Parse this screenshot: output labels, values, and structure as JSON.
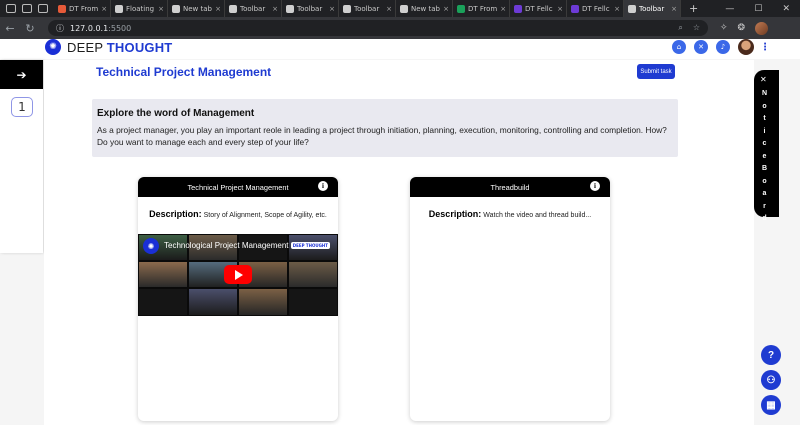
{
  "browser": {
    "tabs": [
      {
        "label": "DT From",
        "color": "#e65a39"
      },
      {
        "label": "Floating",
        "color": "#cfcfcf"
      },
      {
        "label": "New tab",
        "color": "#cfcfcf"
      },
      {
        "label": "Toolbar",
        "color": "#cfcfcf"
      },
      {
        "label": "Toolbar",
        "color": "#cfcfcf"
      },
      {
        "label": "Toolbar",
        "color": "#cfcfcf"
      },
      {
        "label": "New tab",
        "color": "#cfcfcf"
      },
      {
        "label": "DT From",
        "color": "#1aa15a"
      },
      {
        "label": "DT Fellc",
        "color": "#6d3bd6"
      },
      {
        "label": "DT Fellc",
        "color": "#6d3bd6"
      },
      {
        "label": "Toolbar",
        "color": "#cfcfcf"
      }
    ],
    "url": "127.0.0.1",
    "port": ":5500"
  },
  "header": {
    "brand_plain": "DEEP",
    "brand_bold": "THOUGHT",
    "icons": [
      "home-icon",
      "tools-icon",
      "bell-icon"
    ]
  },
  "rail": {
    "toggle_icon": "arrow-right-icon",
    "item_number": "1"
  },
  "main": {
    "title": "Technical Project Management",
    "submit_label": "Submit task",
    "explore_heading": "Explore the word of Management",
    "explore_text": "As a project manager, you play an important reole in leading a project through initiation, planning, execution, monitoring, controlling and completion. How? Do you want to manage each and every step of your life?"
  },
  "cards": [
    {
      "header": "Technical Project Management",
      "desc_label": "Description:",
      "desc_text": "Story of Alignment, Scope of Agility, etc.",
      "video_title": "Technological Project Management",
      "video_badge": "DEEP THOUGHT"
    },
    {
      "header": "Threadbuild",
      "desc_label": "Description:",
      "desc_text": "Watch the video and thread build..."
    }
  ],
  "notice_board": {
    "letters": [
      "N",
      "o",
      "t",
      "i",
      "c",
      "e",
      "B",
      "o",
      "a",
      "r",
      "d"
    ]
  },
  "fabs": {
    "help_label": "?",
    "icons": [
      "help-icon",
      "community-icon",
      "calendar-icon"
    ]
  }
}
